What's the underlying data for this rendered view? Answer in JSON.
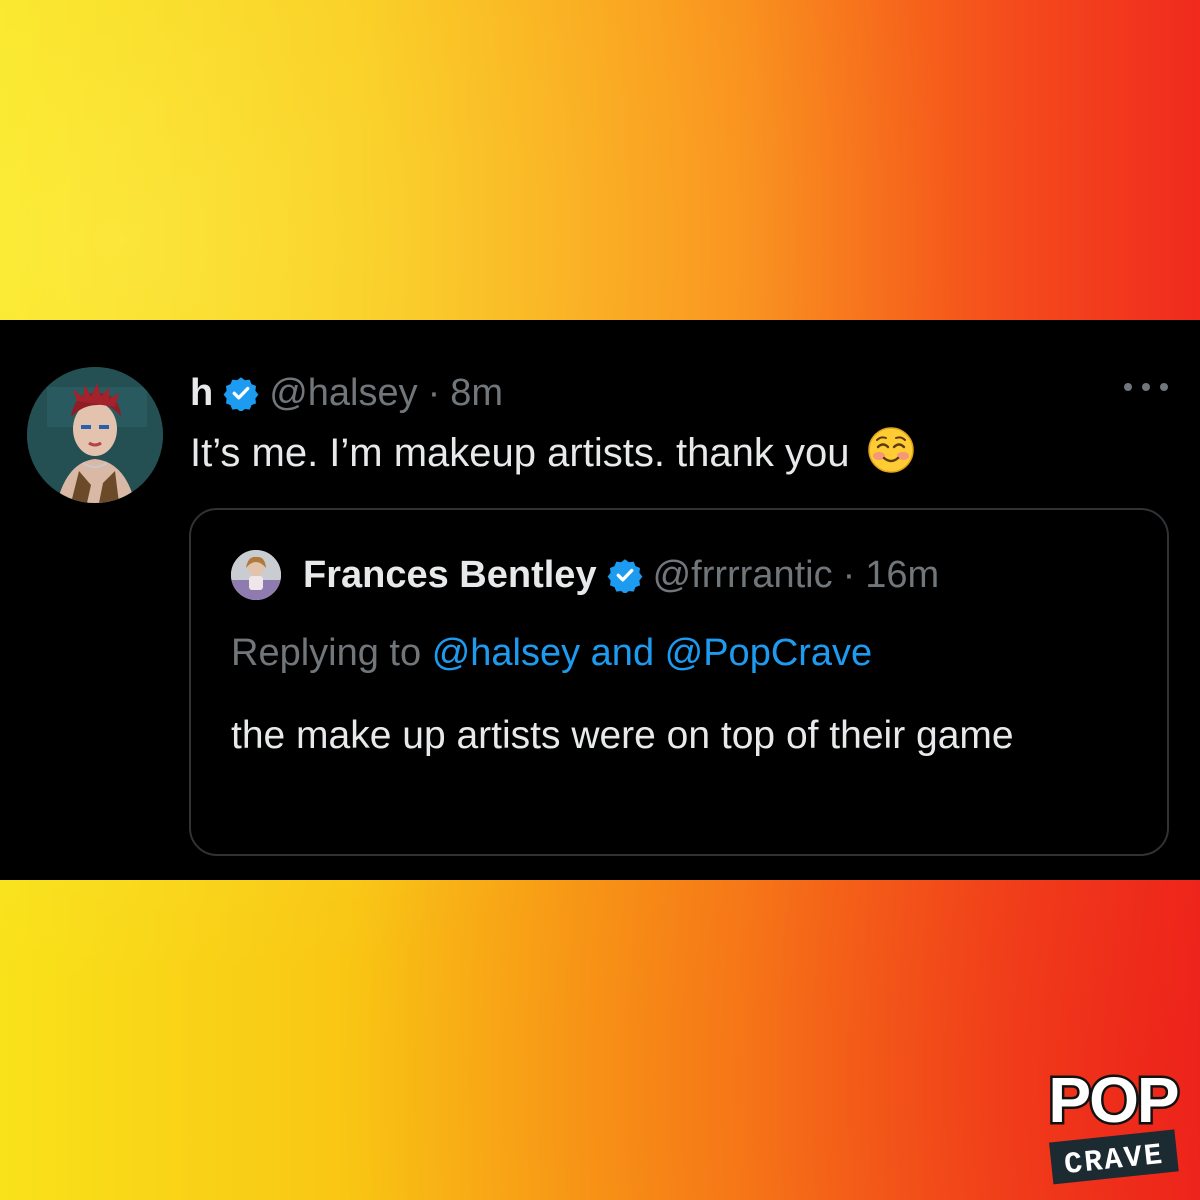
{
  "tweet": {
    "display_name": "h",
    "handle": "@halsey",
    "separator": "·",
    "time": "8m",
    "text": "It’s me. I’m makeup artists. thank you",
    "emoji_icon": "smiling-blush-emoji",
    "more_icon": "more-dots-icon"
  },
  "quoted": {
    "display_name": "Frances Bentley",
    "handle": "@frrrrantic",
    "separator": "·",
    "time": "16m",
    "replying_prefix": "Replying to",
    "mention_1": "@halsey",
    "conjunction": "and",
    "mention_2": "@PopCrave",
    "text": "the make up artists were on top of their game"
  },
  "logo": {
    "line1": "POP",
    "line2": "CRAVE"
  },
  "colors": {
    "background_gradient": [
      "#f9e21a",
      "#f98a18",
      "#f02a1e"
    ],
    "panel": "#000000",
    "text_primary": "#e7e9ea",
    "text_secondary": "#71767b",
    "link": "#1d9bf0",
    "verified": "#1d9bf0",
    "quote_border": "#2f3336"
  }
}
